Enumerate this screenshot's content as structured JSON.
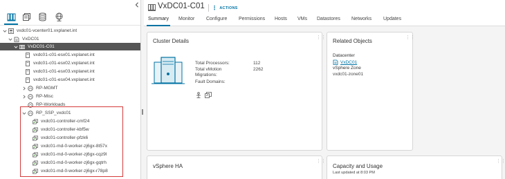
{
  "navigator": {
    "tabs": [
      {
        "icon": "hosts-and-clusters-icon"
      },
      {
        "icon": "vms-and-templates-icon"
      },
      {
        "icon": "storage-icon"
      },
      {
        "icon": "networking-icon"
      }
    ],
    "tree": [
      {
        "label": "vxdc01-vcenter01.vxplanet.int",
        "icon": "vcenter-icon",
        "expanded": true
      },
      {
        "label": "VxDC01",
        "icon": "datacenter-icon",
        "expanded": true
      },
      {
        "label": "VxDC01-C01",
        "icon": "cluster-icon",
        "expanded": true,
        "selected": true
      },
      {
        "label": "vxdc01-c01-esx01.vxplanet.int",
        "icon": "host-icon"
      },
      {
        "label": "vxdc01-c01-esx02.vxplanet.int",
        "icon": "host-icon"
      },
      {
        "label": "vxdc01-c01-esx03.vxplanet.int",
        "icon": "host-icon"
      },
      {
        "label": "vxdc01-c01-esx04.vxplanet.int",
        "icon": "host-icon"
      },
      {
        "label": "RP-MGMT",
        "icon": "resource-pool-icon",
        "expanded": false
      },
      {
        "label": "RP-Misc",
        "icon": "resource-pool-icon",
        "expanded": false
      },
      {
        "label": "RP-Workloads",
        "icon": "resource-pool-icon"
      },
      {
        "label": "RP_SSP_vxdc01",
        "icon": "resource-pool-icon",
        "expanded": true
      },
      {
        "label": "vxdc01-controller-cmf24",
        "icon": "vm-icon"
      },
      {
        "label": "vxdc01-controller-kbf5w",
        "icon": "vm-icon"
      },
      {
        "label": "vxdc01-controller-pfzk6",
        "icon": "vm-icon"
      },
      {
        "label": "vxdc01-md-0-worker-zj6gx-8t57x",
        "icon": "vm-icon"
      },
      {
        "label": "vxdc01-md-0-worker-zj6gx-cqz9l",
        "icon": "vm-icon"
      },
      {
        "label": "vxdc01-md-0-worker-zj6gx-gqtrh",
        "icon": "vm-icon"
      },
      {
        "label": "vxdc01-md-0-worker-zj6gx-r78p8",
        "icon": "vm-icon"
      }
    ]
  },
  "header": {
    "title": "VxDC01-C01",
    "actions_label": "ACTIONS",
    "tabs": [
      "Summary",
      "Monitor",
      "Configure",
      "Permissions",
      "Hosts",
      "VMs",
      "Datastores",
      "Networks",
      "Updates"
    ],
    "active_tab": "Summary"
  },
  "cluster_details": {
    "title": "Cluster Details",
    "total_processors_label": "Total Processors:",
    "total_processors_value": "112",
    "vmotion_label_line1": "Total vMotion",
    "vmotion_label_line2": "Migrations:",
    "vmotion_value": "2262",
    "fault_domains_label": "Fault Domains:"
  },
  "related_objects": {
    "title": "Related Objects",
    "datacenter_label": "Datacenter",
    "datacenter_link": "VxDC01",
    "zone_label": "vSphere Zone",
    "zone_value": "vxdc01-zone01"
  },
  "vsphere_ha": {
    "title": "vSphere HA"
  },
  "capacity": {
    "title": "Capacity and Usage",
    "updated": "Last updated at 8:03 PM"
  },
  "colors": {
    "accent": "#0072a3",
    "selected_row": "#565656",
    "highlight_box": "#d63a3a"
  }
}
